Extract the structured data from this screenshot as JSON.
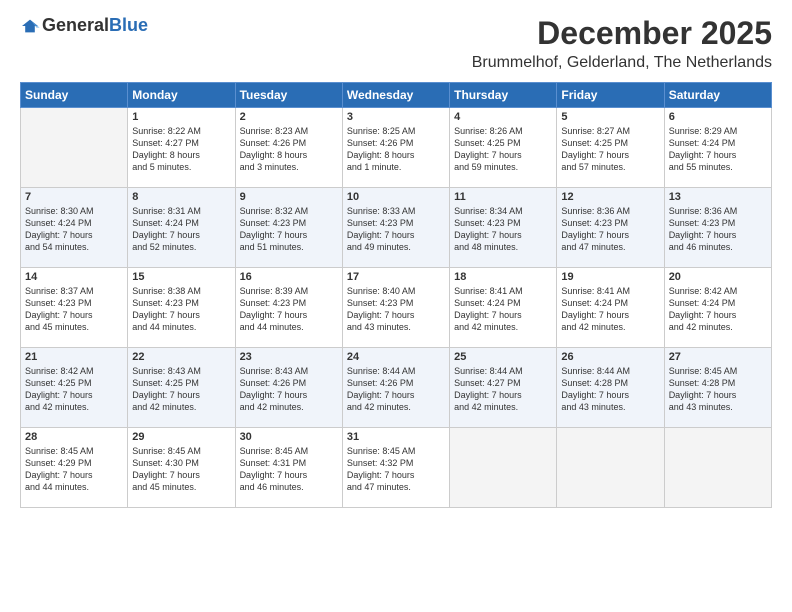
{
  "logo": {
    "general": "General",
    "blue": "Blue"
  },
  "header": {
    "month": "December 2025",
    "location": "Brummelhof, Gelderland, The Netherlands"
  },
  "weekdays": [
    "Sunday",
    "Monday",
    "Tuesday",
    "Wednesday",
    "Thursday",
    "Friday",
    "Saturday"
  ],
  "weeks": [
    [
      {
        "day": "",
        "info": ""
      },
      {
        "day": "1",
        "info": "Sunrise: 8:22 AM\nSunset: 4:27 PM\nDaylight: 8 hours\nand 5 minutes."
      },
      {
        "day": "2",
        "info": "Sunrise: 8:23 AM\nSunset: 4:26 PM\nDaylight: 8 hours\nand 3 minutes."
      },
      {
        "day": "3",
        "info": "Sunrise: 8:25 AM\nSunset: 4:26 PM\nDaylight: 8 hours\nand 1 minute."
      },
      {
        "day": "4",
        "info": "Sunrise: 8:26 AM\nSunset: 4:25 PM\nDaylight: 7 hours\nand 59 minutes."
      },
      {
        "day": "5",
        "info": "Sunrise: 8:27 AM\nSunset: 4:25 PM\nDaylight: 7 hours\nand 57 minutes."
      },
      {
        "day": "6",
        "info": "Sunrise: 8:29 AM\nSunset: 4:24 PM\nDaylight: 7 hours\nand 55 minutes."
      }
    ],
    [
      {
        "day": "7",
        "info": "Sunrise: 8:30 AM\nSunset: 4:24 PM\nDaylight: 7 hours\nand 54 minutes."
      },
      {
        "day": "8",
        "info": "Sunrise: 8:31 AM\nSunset: 4:24 PM\nDaylight: 7 hours\nand 52 minutes."
      },
      {
        "day": "9",
        "info": "Sunrise: 8:32 AM\nSunset: 4:23 PM\nDaylight: 7 hours\nand 51 minutes."
      },
      {
        "day": "10",
        "info": "Sunrise: 8:33 AM\nSunset: 4:23 PM\nDaylight: 7 hours\nand 49 minutes."
      },
      {
        "day": "11",
        "info": "Sunrise: 8:34 AM\nSunset: 4:23 PM\nDaylight: 7 hours\nand 48 minutes."
      },
      {
        "day": "12",
        "info": "Sunrise: 8:36 AM\nSunset: 4:23 PM\nDaylight: 7 hours\nand 47 minutes."
      },
      {
        "day": "13",
        "info": "Sunrise: 8:36 AM\nSunset: 4:23 PM\nDaylight: 7 hours\nand 46 minutes."
      }
    ],
    [
      {
        "day": "14",
        "info": "Sunrise: 8:37 AM\nSunset: 4:23 PM\nDaylight: 7 hours\nand 45 minutes."
      },
      {
        "day": "15",
        "info": "Sunrise: 8:38 AM\nSunset: 4:23 PM\nDaylight: 7 hours\nand 44 minutes."
      },
      {
        "day": "16",
        "info": "Sunrise: 8:39 AM\nSunset: 4:23 PM\nDaylight: 7 hours\nand 44 minutes."
      },
      {
        "day": "17",
        "info": "Sunrise: 8:40 AM\nSunset: 4:23 PM\nDaylight: 7 hours\nand 43 minutes."
      },
      {
        "day": "18",
        "info": "Sunrise: 8:41 AM\nSunset: 4:24 PM\nDaylight: 7 hours\nand 42 minutes."
      },
      {
        "day": "19",
        "info": "Sunrise: 8:41 AM\nSunset: 4:24 PM\nDaylight: 7 hours\nand 42 minutes."
      },
      {
        "day": "20",
        "info": "Sunrise: 8:42 AM\nSunset: 4:24 PM\nDaylight: 7 hours\nand 42 minutes."
      }
    ],
    [
      {
        "day": "21",
        "info": "Sunrise: 8:42 AM\nSunset: 4:25 PM\nDaylight: 7 hours\nand 42 minutes."
      },
      {
        "day": "22",
        "info": "Sunrise: 8:43 AM\nSunset: 4:25 PM\nDaylight: 7 hours\nand 42 minutes."
      },
      {
        "day": "23",
        "info": "Sunrise: 8:43 AM\nSunset: 4:26 PM\nDaylight: 7 hours\nand 42 minutes."
      },
      {
        "day": "24",
        "info": "Sunrise: 8:44 AM\nSunset: 4:26 PM\nDaylight: 7 hours\nand 42 minutes."
      },
      {
        "day": "25",
        "info": "Sunrise: 8:44 AM\nSunset: 4:27 PM\nDaylight: 7 hours\nand 42 minutes."
      },
      {
        "day": "26",
        "info": "Sunrise: 8:44 AM\nSunset: 4:28 PM\nDaylight: 7 hours\nand 43 minutes."
      },
      {
        "day": "27",
        "info": "Sunrise: 8:45 AM\nSunset: 4:28 PM\nDaylight: 7 hours\nand 43 minutes."
      }
    ],
    [
      {
        "day": "28",
        "info": "Sunrise: 8:45 AM\nSunset: 4:29 PM\nDaylight: 7 hours\nand 44 minutes."
      },
      {
        "day": "29",
        "info": "Sunrise: 8:45 AM\nSunset: 4:30 PM\nDaylight: 7 hours\nand 45 minutes."
      },
      {
        "day": "30",
        "info": "Sunrise: 8:45 AM\nSunset: 4:31 PM\nDaylight: 7 hours\nand 46 minutes."
      },
      {
        "day": "31",
        "info": "Sunrise: 8:45 AM\nSunset: 4:32 PM\nDaylight: 7 hours\nand 47 minutes."
      },
      {
        "day": "",
        "info": ""
      },
      {
        "day": "",
        "info": ""
      },
      {
        "day": "",
        "info": ""
      }
    ]
  ]
}
